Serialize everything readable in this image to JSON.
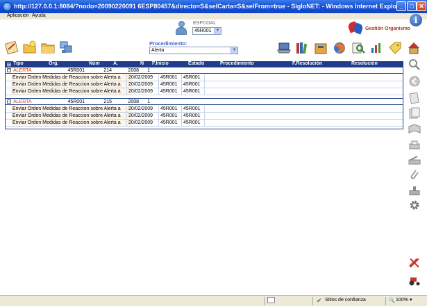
{
  "window": {
    "title": "http://127.0.0.1:8084/?nodo=20090220091 6ESP80457&directo=S&selCarta=S&selFrom=true - SigloNET: - Windows Internet Explorer",
    "minimize": "_",
    "maximize": "□",
    "close": "✕"
  },
  "menu": {
    "items": [
      "Aplicación",
      "Ayuda"
    ]
  },
  "header": {
    "user_label": "ESPCOAL",
    "user_value": "45R001",
    "org_label": "Gestión Organismo"
  },
  "toolbar": {
    "procedure_label": "Procedimiento:",
    "procedure_value": "Alerta"
  },
  "grid": {
    "columns": [
      "Tipo",
      "Org.",
      "Núm",
      "A.",
      "N",
      "F.Inicio",
      "Estado",
      "Procedimiento",
      "F.Resolución",
      "Resolución"
    ],
    "groups": [
      {
        "tipo": "ALERTA",
        "org": "45R001",
        "num": "214",
        "anio": "2008",
        "n": "1",
        "details": [
          {
            "desc": "Enviar Orden Medidas de Reaccion sobre Alerta a",
            "fecha": "20/02/2009",
            "o1": "45R001",
            "o2": "45R001"
          },
          {
            "desc": "Enviar Orden Medidas de Reaccion sobre Alerta a",
            "fecha": "20/02/2009",
            "o1": "45R001",
            "o2": "45R001"
          },
          {
            "desc": "Enviar Orden Medidas de Reaccion sobre Alerta a",
            "fecha": "20/02/2009",
            "o1": "45R001",
            "o2": "45R001"
          }
        ]
      },
      {
        "tipo": "ALERTA",
        "org": "45R001",
        "num": "215",
        "anio": "2008",
        "n": "1",
        "details": [
          {
            "desc": "Enviar Orden Medidas de Reaccion sobre Alerta a",
            "fecha": "20/02/2009",
            "o1": "45R001",
            "o2": "45R001"
          },
          {
            "desc": "Enviar Orden Medidas de Reaccion sobre Alerta a",
            "fecha": "20/02/2009",
            "o1": "45R001",
            "o2": "45R001"
          },
          {
            "desc": "Enviar Orden Medidas de Reaccion sobre Alerta a",
            "fecha": "20/02/2009",
            "o1": "45R001",
            "o2": "45R001"
          }
        ]
      }
    ]
  },
  "status": {
    "zone": "Sitios de confianza",
    "zoom": "100%"
  }
}
